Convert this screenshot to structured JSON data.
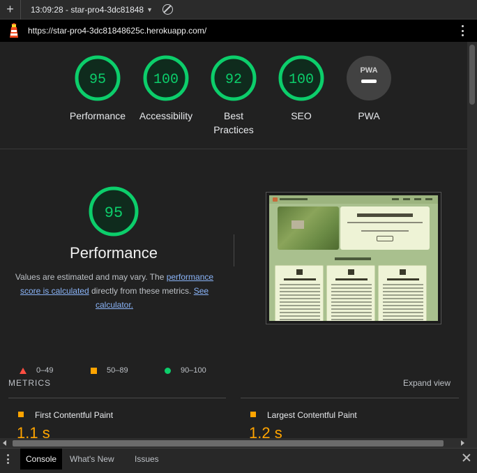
{
  "toolbar": {
    "new_tab_label": "+",
    "session": "13:09:28 - star-pro4-3dc81848"
  },
  "address": {
    "url": "https://star-pro4-3dc81848625c.herokuapp.com/"
  },
  "gauges": [
    {
      "score": "95",
      "label": "Performance"
    },
    {
      "score": "100",
      "label": "Accessibility"
    },
    {
      "score": "92",
      "label": "Best Practices"
    },
    {
      "score": "100",
      "label": "SEO"
    },
    {
      "score": "",
      "badge": "PWA",
      "label": "PWA"
    }
  ],
  "performance": {
    "score": "95",
    "title": "Performance",
    "desc_1": "Values are estimated and may vary. The ",
    "desc_link_1": "performance score is calculated",
    "desc_2": " directly from these metrics. ",
    "desc_link_2": "See calculator."
  },
  "legend": [
    {
      "range": "0–49",
      "color": "#ff4e42"
    },
    {
      "range": "50–89",
      "color": "#ffa400"
    },
    {
      "range": "90–100",
      "color": "#0cce6b"
    }
  ],
  "metrics": {
    "title": "METRICS",
    "expand": "Expand view",
    "items": [
      {
        "name": "First Contentful Paint",
        "value": "1.1 s"
      },
      {
        "name": "Largest Contentful Paint",
        "value": "1.2 s"
      }
    ]
  },
  "drawer": {
    "tabs": [
      "Console",
      "What's New",
      "Issues"
    ]
  },
  "colors": {
    "pass": "#0cce6b",
    "average": "#ffa400",
    "fail": "#ff4e42",
    "link": "#8ab4f8"
  }
}
